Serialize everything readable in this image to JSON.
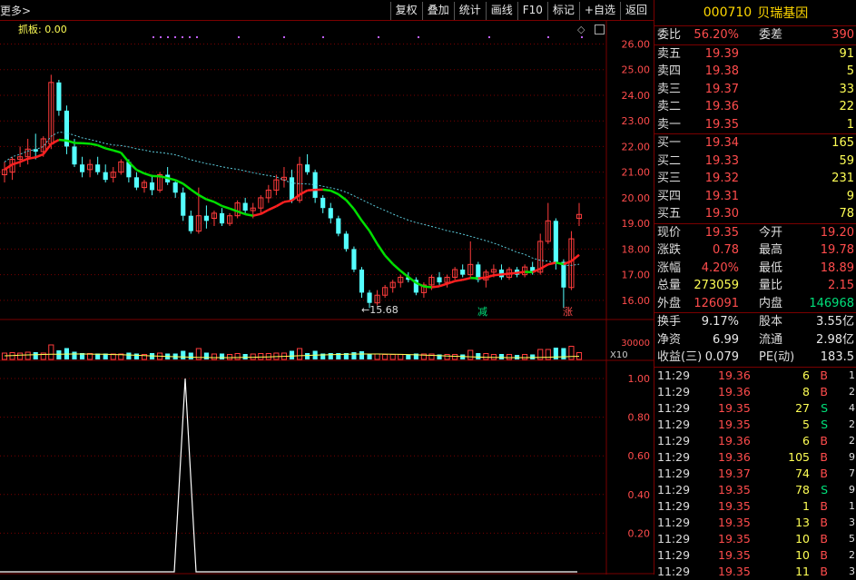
{
  "toolbar": {
    "more_label": "更多>",
    "buttons": [
      "复权",
      "叠加",
      "统计",
      "画线",
      "F10",
      "标记",
      "+自选",
      "返回"
    ]
  },
  "indicator": {
    "grab_label": "抓板: 0.00"
  },
  "price_chart": {
    "y_ticks": [
      "26.00",
      "25.00",
      "24.00",
      "23.00",
      "22.00",
      "21.00",
      "20.00",
      "19.00",
      "18.00",
      "17.00",
      "16.00"
    ],
    "low_marker": "15.68",
    "signal_down": "减",
    "signal_up": "涨"
  },
  "volume_chart": {
    "y_tick": "30000",
    "unit": "X10"
  },
  "osc_chart": {
    "y_ticks": [
      "1.00",
      "0.80",
      "0.60",
      "0.40",
      "0.20"
    ]
  },
  "stock": {
    "code": "000710",
    "name": "贝瑞基因"
  },
  "weibi": {
    "label1": "委比",
    "val1": "56.20%",
    "label2": "委差",
    "val2": "390"
  },
  "asks": [
    {
      "label": "卖五",
      "price": "19.39",
      "vol": "91"
    },
    {
      "label": "卖四",
      "price": "19.38",
      "vol": "5"
    },
    {
      "label": "卖三",
      "price": "19.37",
      "vol": "33"
    },
    {
      "label": "卖二",
      "price": "19.36",
      "vol": "22"
    },
    {
      "label": "卖一",
      "price": "19.35",
      "vol": "1"
    }
  ],
  "bids": [
    {
      "label": "买一",
      "price": "19.34",
      "vol": "165"
    },
    {
      "label": "买二",
      "price": "19.33",
      "vol": "59"
    },
    {
      "label": "买三",
      "price": "19.32",
      "vol": "231"
    },
    {
      "label": "买四",
      "price": "19.31",
      "vol": "9"
    },
    {
      "label": "买五",
      "price": "19.30",
      "vol": "78"
    }
  ],
  "quote": [
    {
      "l1": "现价",
      "v1": "19.35",
      "l2": "今开",
      "v2": "19.20"
    },
    {
      "l1": "涨跌",
      "v1": "0.78",
      "l2": "最高",
      "v2": "19.78"
    },
    {
      "l1": "涨幅",
      "v1": "4.20%",
      "l2": "最低",
      "v2": "18.89"
    },
    {
      "l1": "总量",
      "v1": "273059",
      "l2": "量比",
      "v2": "2.15"
    },
    {
      "l1": "外盘",
      "v1": "126091",
      "l2": "内盘",
      "v2": "146968"
    }
  ],
  "fundamentals": [
    {
      "l1": "换手",
      "v1": "9.17%",
      "l2": "股本",
      "v2": "3.55亿"
    },
    {
      "l1": "净资",
      "v1": "6.99",
      "l2": "流通",
      "v2": "2.98亿"
    },
    {
      "l1": "收益(三)",
      "v1": "0.079",
      "l2": "PE(动)",
      "v2": "183.5"
    }
  ],
  "ticks": [
    {
      "time": "11:29",
      "price": "19.36",
      "vol": "6",
      "side": "B",
      "n": "1"
    },
    {
      "time": "11:29",
      "price": "19.36",
      "vol": "8",
      "side": "B",
      "n": "2"
    },
    {
      "time": "11:29",
      "price": "19.35",
      "vol": "27",
      "side": "S",
      "n": "4"
    },
    {
      "time": "11:29",
      "price": "19.35",
      "vol": "5",
      "side": "S",
      "n": "2"
    },
    {
      "time": "11:29",
      "price": "19.36",
      "vol": "6",
      "side": "B",
      "n": "2"
    },
    {
      "time": "11:29",
      "price": "19.36",
      "vol": "105",
      "side": "B",
      "n": "9"
    },
    {
      "time": "11:29",
      "price": "19.37",
      "vol": "74",
      "side": "B",
      "n": "7"
    },
    {
      "time": "11:29",
      "price": "19.35",
      "vol": "78",
      "side": "S",
      "n": "9"
    },
    {
      "time": "11:29",
      "price": "19.35",
      "vol": "1",
      "side": "B",
      "n": "1"
    },
    {
      "time": "11:29",
      "price": "19.35",
      "vol": "13",
      "side": "B",
      "n": "3"
    },
    {
      "time": "11:29",
      "price": "19.35",
      "vol": "10",
      "side": "B",
      "n": "5"
    },
    {
      "time": "11:29",
      "price": "19.35",
      "vol": "10",
      "side": "B",
      "n": "2"
    },
    {
      "time": "11:29",
      "price": "19.35",
      "vol": "11",
      "side": "B",
      "n": "3"
    }
  ],
  "colors": {
    "up": "#ff3c3c",
    "down": "#54ffff",
    "ma_green": "#00e000",
    "ma_red": "#ff2020",
    "ma_dash": "#5bc8d8",
    "grid": "#7a0000"
  },
  "chart_data": {
    "type": "candlestick",
    "y_axis": {
      "min": 15.5,
      "max": 26.3
    },
    "candles": [
      [
        20.9,
        21.4,
        20.6,
        21.1
      ],
      [
        21.0,
        21.6,
        20.7,
        21.5
      ],
      [
        21.5,
        22.0,
        21.2,
        21.6
      ],
      [
        21.6,
        22.3,
        21.3,
        21.9
      ],
      [
        21.9,
        22.5,
        21.5,
        21.8
      ],
      [
        21.8,
        22.4,
        21.6,
        22.3
      ],
      [
        22.1,
        24.8,
        21.9,
        24.5
      ],
      [
        24.5,
        24.6,
        23.2,
        23.4
      ],
      [
        23.4,
        23.6,
        21.7,
        22.0
      ],
      [
        22.0,
        22.3,
        21.2,
        21.3
      ],
      [
        21.3,
        21.6,
        20.8,
        21.0
      ],
      [
        21.1,
        21.5,
        20.8,
        21.3
      ],
      [
        21.3,
        21.6,
        20.9,
        21.0
      ],
      [
        21.0,
        21.3,
        20.6,
        20.7
      ],
      [
        20.8,
        21.2,
        20.6,
        21.0
      ],
      [
        21.0,
        21.5,
        20.9,
        21.4
      ],
      [
        21.4,
        21.5,
        20.6,
        20.8
      ],
      [
        20.8,
        21.0,
        20.3,
        20.4
      ],
      [
        20.4,
        20.7,
        20.2,
        20.6
      ],
      [
        20.6,
        20.9,
        20.1,
        20.3
      ],
      [
        20.3,
        21.0,
        20.2,
        20.9
      ],
      [
        20.9,
        21.2,
        20.5,
        20.6
      ],
      [
        20.6,
        20.7,
        20.0,
        20.2
      ],
      [
        20.2,
        20.4,
        19.1,
        19.3
      ],
      [
        19.3,
        19.5,
        18.6,
        18.7
      ],
      [
        18.7,
        20.4,
        18.6,
        19.3
      ],
      [
        19.3,
        19.7,
        18.8,
        19.1
      ],
      [
        19.2,
        19.5,
        18.9,
        19.4
      ],
      [
        19.4,
        19.6,
        18.9,
        19.0
      ],
      [
        19.0,
        19.4,
        18.9,
        19.3
      ],
      [
        19.3,
        19.9,
        19.2,
        19.8
      ],
      [
        19.8,
        20.0,
        19.4,
        19.5
      ],
      [
        19.5,
        19.8,
        19.2,
        19.6
      ],
      [
        19.6,
        20.1,
        19.4,
        20.0
      ],
      [
        20.0,
        20.5,
        19.8,
        20.3
      ],
      [
        20.3,
        20.9,
        20.1,
        20.7
      ],
      [
        20.7,
        21.2,
        20.4,
        20.8
      ],
      [
        20.8,
        21.1,
        19.8,
        19.9
      ],
      [
        19.9,
        21.6,
        19.8,
        21.3
      ],
      [
        21.3,
        21.7,
        20.9,
        21.0
      ],
      [
        21.0,
        21.1,
        19.8,
        20.0
      ],
      [
        20.0,
        20.1,
        19.4,
        19.6
      ],
      [
        19.6,
        19.8,
        19.0,
        19.2
      ],
      [
        19.2,
        19.3,
        18.5,
        18.6
      ],
      [
        18.6,
        18.7,
        17.9,
        18.0
      ],
      [
        18.0,
        18.1,
        17.1,
        17.2
      ],
      [
        17.2,
        17.3,
        16.1,
        16.3
      ],
      [
        16.3,
        16.4,
        15.7,
        15.9
      ],
      [
        15.9,
        16.4,
        15.8,
        16.2
      ],
      [
        16.2,
        16.6,
        16.1,
        16.5
      ],
      [
        16.5,
        16.8,
        16.3,
        16.7
      ],
      [
        16.7,
        17.0,
        16.5,
        16.9
      ],
      [
        16.9,
        17.1,
        16.7,
        16.8
      ],
      [
        16.8,
        16.9,
        16.2,
        16.3
      ],
      [
        16.3,
        16.7,
        16.1,
        16.6
      ],
      [
        16.6,
        17.0,
        16.4,
        16.9
      ],
      [
        16.9,
        17.1,
        16.6,
        16.7
      ],
      [
        16.7,
        17.0,
        16.5,
        16.9
      ],
      [
        16.9,
        17.3,
        16.8,
        17.2
      ],
      [
        17.2,
        17.4,
        16.9,
        17.0
      ],
      [
        17.0,
        18.3,
        16.9,
        17.4
      ],
      [
        17.4,
        17.5,
        16.7,
        16.8
      ],
      [
        16.8,
        17.2,
        16.5,
        17.1
      ],
      [
        17.1,
        17.4,
        16.9,
        17.2
      ],
      [
        17.2,
        17.4,
        16.8,
        16.9
      ],
      [
        16.9,
        17.3,
        16.8,
        17.2
      ],
      [
        17.2,
        17.3,
        16.9,
        17.0
      ],
      [
        17.0,
        17.4,
        16.9,
        17.3
      ],
      [
        17.3,
        17.5,
        17.0,
        17.1
      ],
      [
        17.1,
        18.6,
        17.0,
        18.3
      ],
      [
        18.3,
        19.8,
        18.2,
        19.1
      ],
      [
        19.1,
        19.2,
        17.2,
        17.5
      ],
      [
        17.5,
        17.6,
        15.7,
        16.5
      ],
      [
        16.5,
        18.7,
        16.4,
        18.4
      ],
      [
        19.2,
        19.8,
        18.9,
        19.35
      ]
    ],
    "ma_short_end": 17.5,
    "ma_long_end": 18.3
  }
}
